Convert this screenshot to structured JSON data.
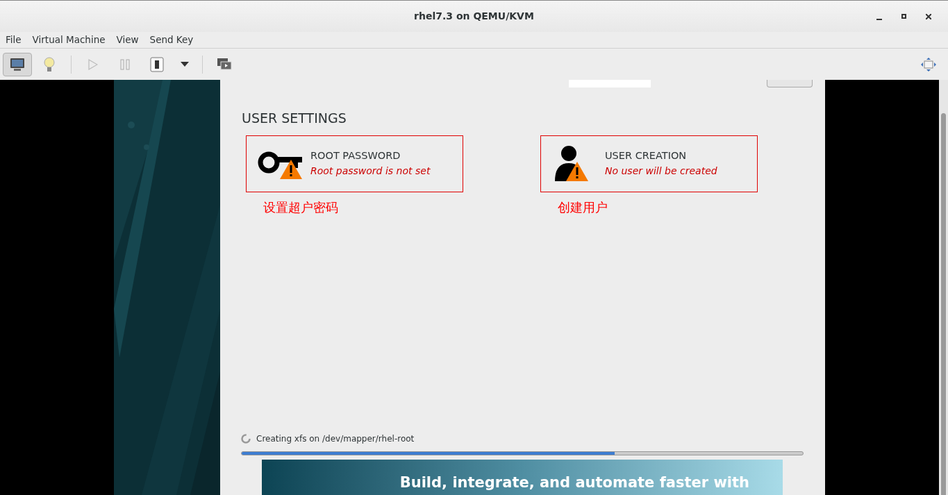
{
  "window": {
    "title": "rhel7.3 on QEMU/KVM"
  },
  "menu": [
    "File",
    "Virtual Machine",
    "View",
    "Send Key"
  ],
  "toolbar": [
    {
      "kind": "console",
      "selected": true
    },
    {
      "kind": "details",
      "selected": false
    },
    {
      "kind": "run",
      "selected": false
    },
    {
      "kind": "pause",
      "selected": false
    },
    {
      "kind": "shutdown",
      "selected": false
    },
    {
      "kind": "dropdown",
      "selected": false
    },
    {
      "kind": "snapshots",
      "selected": false
    }
  ],
  "section": {
    "title": "USER SETTINGS"
  },
  "spokes": [
    {
      "kind": "password",
      "title": "ROOT PASSWORD",
      "status": "Root password is not set",
      "note": "设置超户密码"
    },
    {
      "kind": "user",
      "title": "USER CREATION",
      "status": "No user will be created",
      "note": "创建用户"
    }
  ],
  "progress": {
    "text": "Creating xfs on /dev/mapper/rhel-root",
    "level": 0.665
  },
  "banner": {
    "headline": "Build, integrate, and automate faster with"
  }
}
